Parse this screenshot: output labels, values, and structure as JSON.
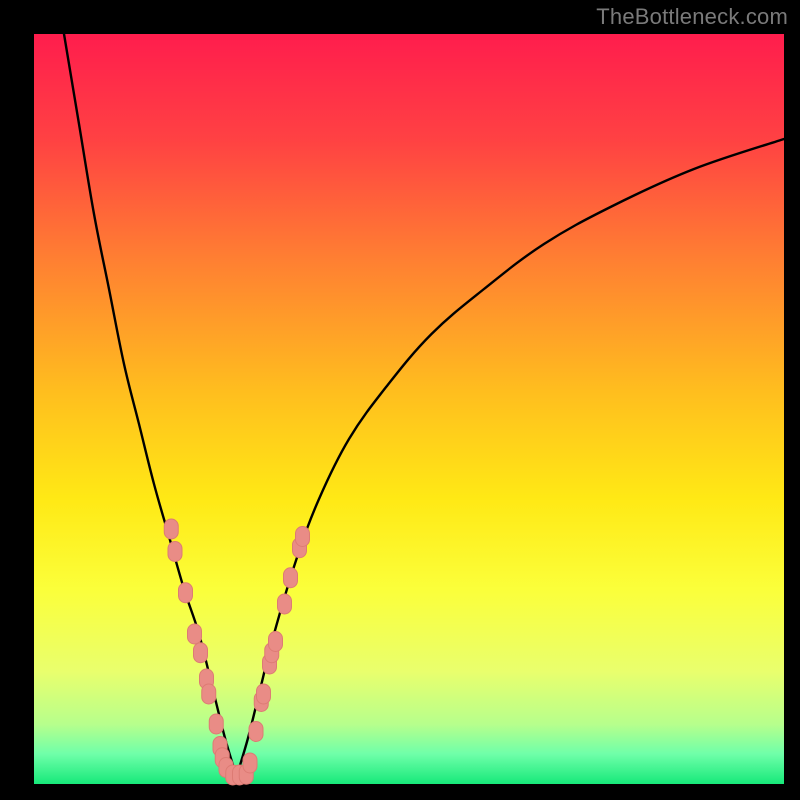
{
  "watermark": "TheBottleneck.com",
  "colors": {
    "frame": "#000000",
    "curve": "#000000",
    "marker_fill": "#e98c86",
    "marker_stroke": "#dd7b74",
    "gradient_stops": [
      {
        "pct": 0,
        "color": "#ff1d4d"
      },
      {
        "pct": 14,
        "color": "#ff4143"
      },
      {
        "pct": 30,
        "color": "#ff7f32"
      },
      {
        "pct": 48,
        "color": "#ffbf1e"
      },
      {
        "pct": 62,
        "color": "#ffe915"
      },
      {
        "pct": 74,
        "color": "#fbff3a"
      },
      {
        "pct": 85,
        "color": "#e9ff6d"
      },
      {
        "pct": 92,
        "color": "#b7ff8c"
      },
      {
        "pct": 96,
        "color": "#6fffa9"
      },
      {
        "pct": 100,
        "color": "#17e97a"
      }
    ]
  },
  "chart_data": {
    "type": "line",
    "title": "",
    "xlabel": "",
    "ylabel": "",
    "xlim": [
      0,
      100
    ],
    "ylim": [
      0,
      100
    ],
    "note": "Bottleneck.com style chart: y is bottleneck % (0 at bottom, 100 at top). Two branches of a V-curve with minimum near x≈27.",
    "series": [
      {
        "name": "left-branch",
        "x": [
          4,
          6,
          8,
          10,
          12,
          14,
          16,
          18,
          20,
          22,
          24,
          25.5,
          27
        ],
        "y": [
          100,
          88,
          76,
          66,
          56,
          48,
          40,
          33,
          26,
          20,
          12,
          6,
          1
        ]
      },
      {
        "name": "right-branch",
        "x": [
          27,
          28.5,
          30,
          32,
          35,
          38,
          42,
          47,
          53,
          60,
          68,
          77,
          88,
          100
        ],
        "y": [
          1,
          6,
          12,
          20,
          30,
          38,
          46,
          53,
          60,
          66,
          72,
          77,
          82,
          86
        ]
      }
    ],
    "markers": {
      "name": "data-points",
      "shape": "rounded-pill",
      "points": [
        {
          "x": 18.3,
          "y": 34.0
        },
        {
          "x": 18.8,
          "y": 31.0
        },
        {
          "x": 20.2,
          "y": 25.5
        },
        {
          "x": 21.4,
          "y": 20.0
        },
        {
          "x": 22.2,
          "y": 17.5
        },
        {
          "x": 23.0,
          "y": 14.0
        },
        {
          "x": 23.3,
          "y": 12.0
        },
        {
          "x": 24.3,
          "y": 8.0
        },
        {
          "x": 24.8,
          "y": 5.0
        },
        {
          "x": 25.1,
          "y": 3.5
        },
        {
          "x": 25.6,
          "y": 2.2
        },
        {
          "x": 26.5,
          "y": 1.2
        },
        {
          "x": 27.4,
          "y": 1.2
        },
        {
          "x": 28.3,
          "y": 1.3
        },
        {
          "x": 28.8,
          "y": 2.8
        },
        {
          "x": 29.6,
          "y": 7.0
        },
        {
          "x": 30.3,
          "y": 11.0
        },
        {
          "x": 30.6,
          "y": 12.0
        },
        {
          "x": 31.4,
          "y": 16.0
        },
        {
          "x": 31.7,
          "y": 17.5
        },
        {
          "x": 32.2,
          "y": 19.0
        },
        {
          "x": 33.4,
          "y": 24.0
        },
        {
          "x": 34.2,
          "y": 27.5
        },
        {
          "x": 35.4,
          "y": 31.5
        },
        {
          "x": 35.8,
          "y": 33.0
        }
      ]
    }
  }
}
